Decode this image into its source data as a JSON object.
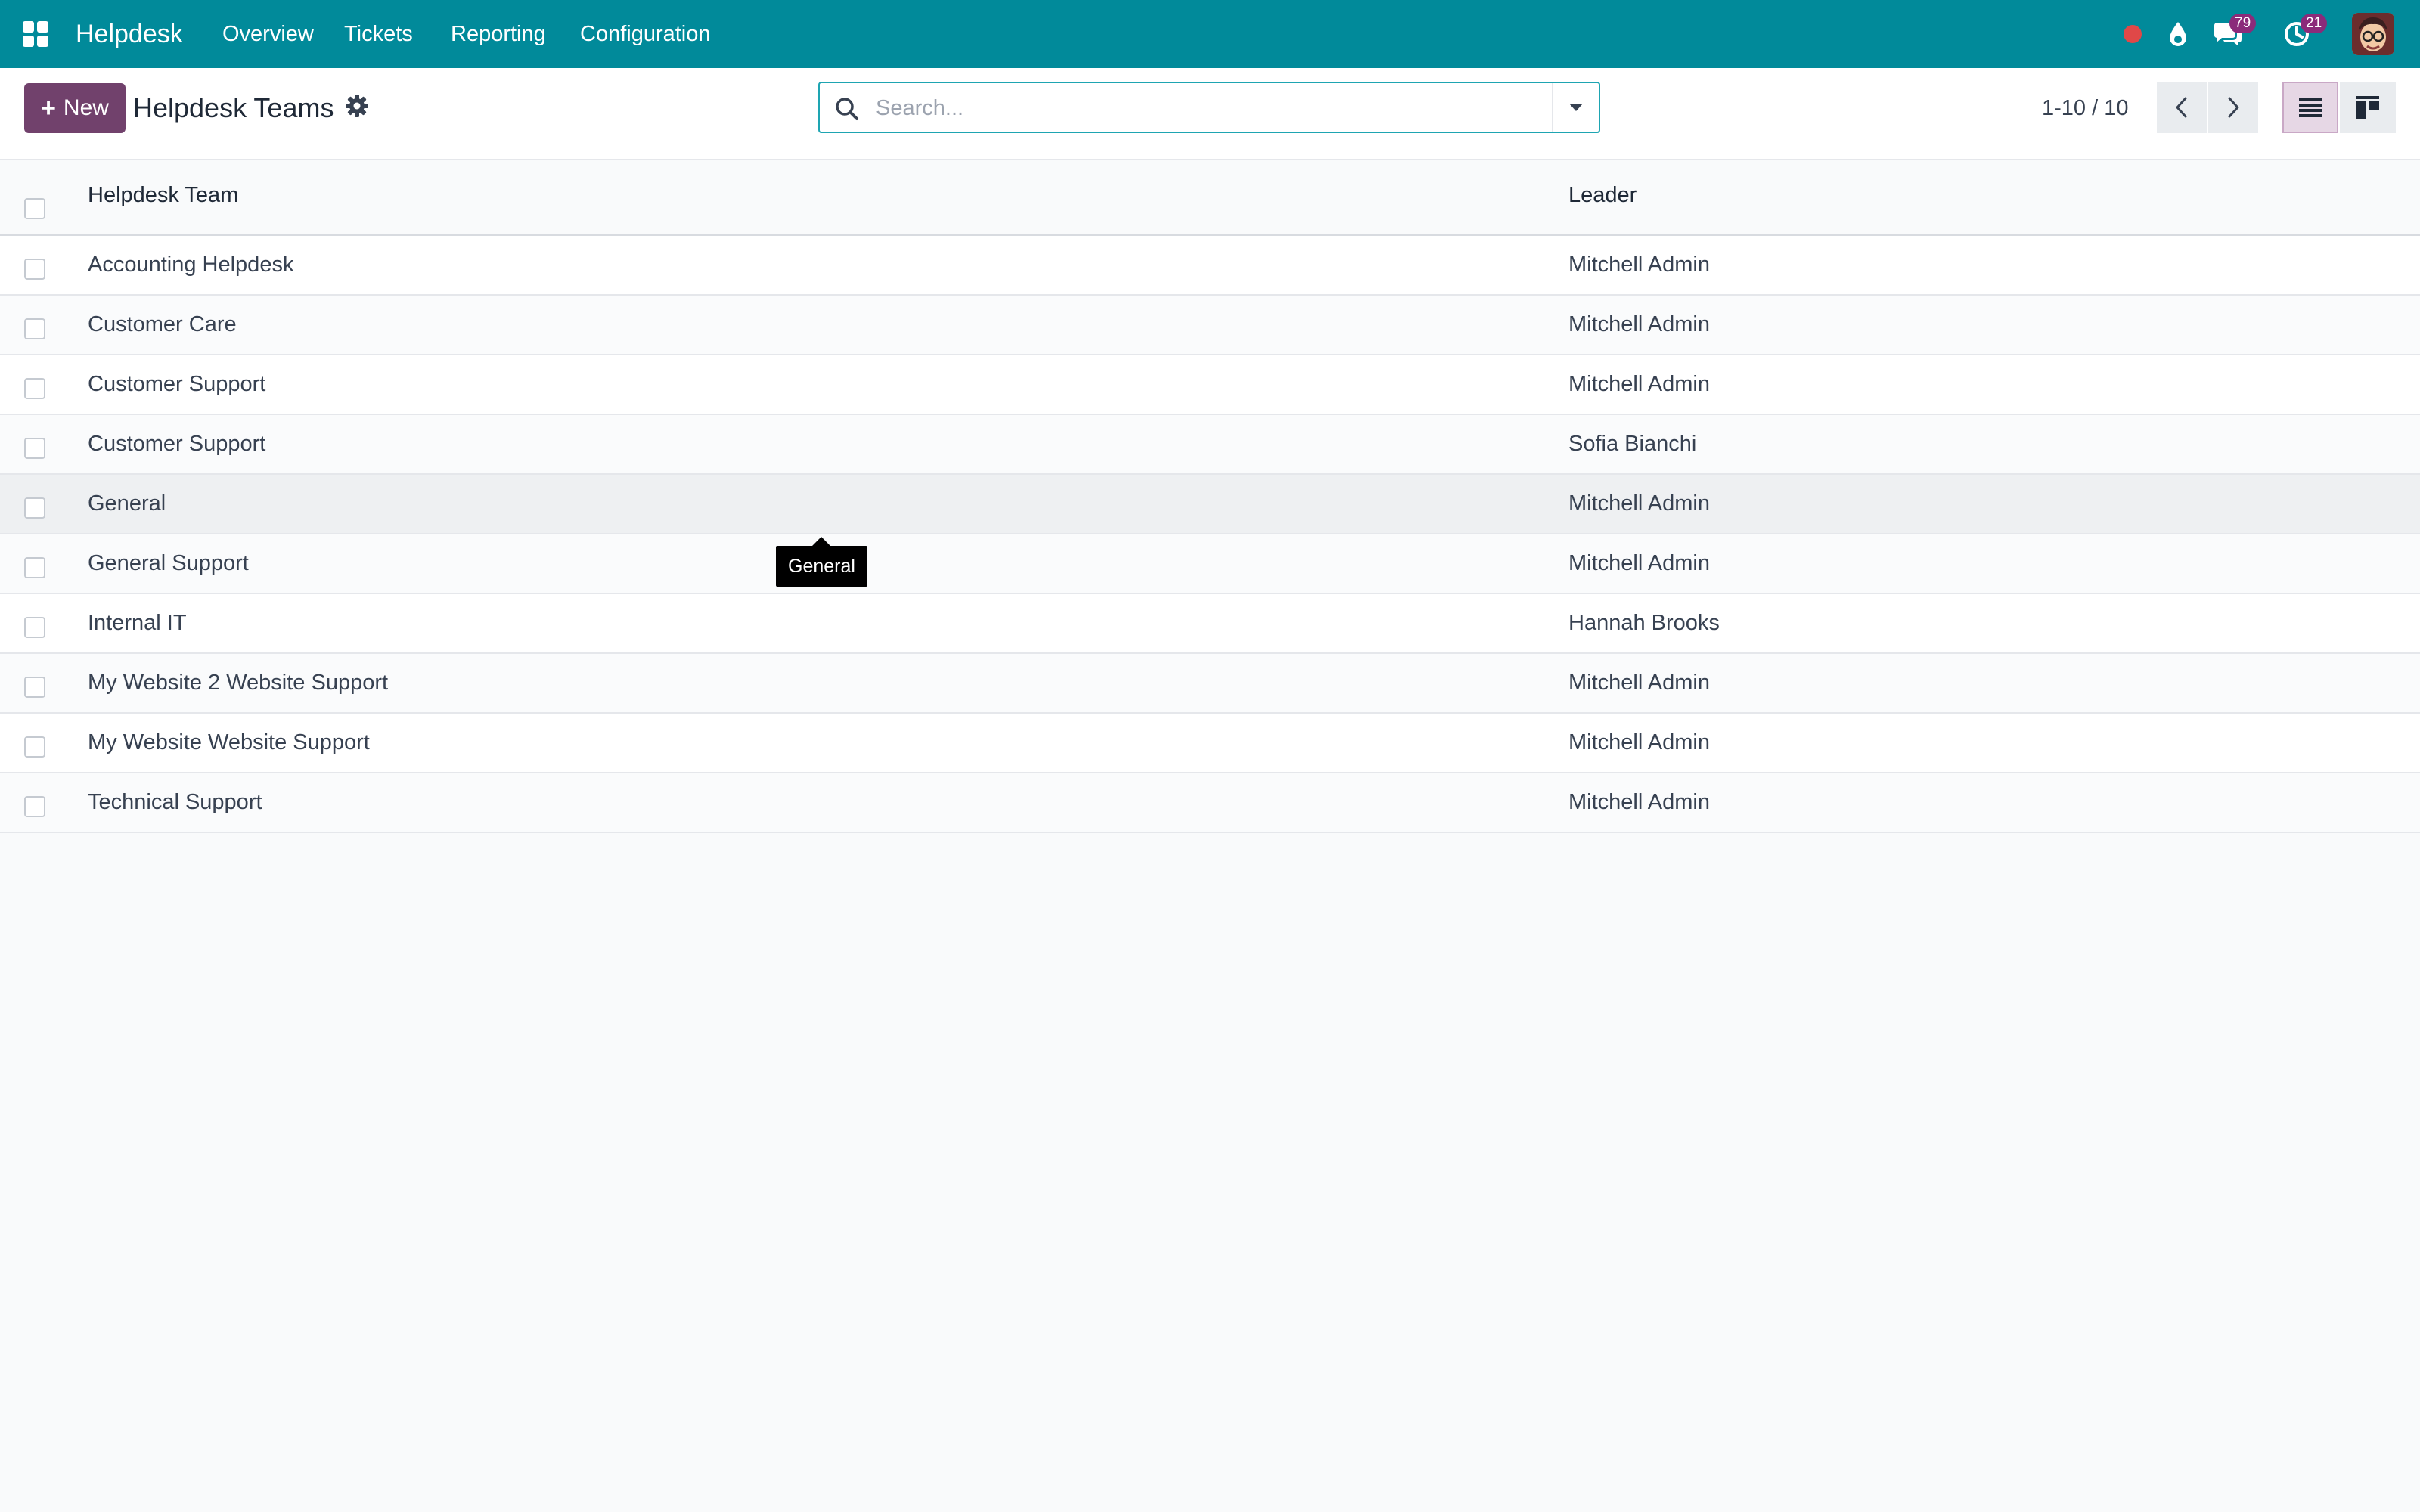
{
  "navbar": {
    "app_name": "Helpdesk",
    "menu": [
      "Overview",
      "Tickets",
      "Reporting",
      "Configuration"
    ],
    "icons": [
      "apps-grid-icon",
      "recording-dot-icon",
      "droplet-icon",
      "chat-icon",
      "clock-icon",
      "avatar"
    ],
    "badges": {
      "messages": "79",
      "activities": "21"
    },
    "colors": {
      "navbar": "#018a9a",
      "badge": "#8b2b7a",
      "recording": "#e04848"
    }
  },
  "control_panel": {
    "new_button_label": "New",
    "title": "Helpdesk Teams",
    "search": {
      "placeholder": "Search...",
      "value": ""
    },
    "pager": "1-10 / 10",
    "views": [
      "list-view-icon",
      "kanban-view-icon"
    ],
    "active_view": "list",
    "accent_color": "#71416c"
  },
  "list": {
    "columns": [
      "Helpdesk Team",
      "Leader"
    ],
    "rows": [
      {
        "team": "Accounting Helpdesk",
        "leader": "Mitchell Admin"
      },
      {
        "team": "Customer Care",
        "leader": "Mitchell Admin"
      },
      {
        "team": "Customer Support",
        "leader": "Mitchell Admin"
      },
      {
        "team": "Customer Support",
        "leader": "Sofia Bianchi"
      },
      {
        "team": "General",
        "leader": "Mitchell Admin"
      },
      {
        "team": "General Support",
        "leader": "Mitchell Admin"
      },
      {
        "team": "Internal IT",
        "leader": "Hannah Brooks"
      },
      {
        "team": "My Website 2 Website Support",
        "leader": "Mitchell Admin"
      },
      {
        "team": "My Website Website Support",
        "leader": "Mitchell Admin"
      },
      {
        "team": "Technical Support",
        "leader": "Mitchell Admin"
      }
    ]
  },
  "tooltip": {
    "text": "General"
  }
}
